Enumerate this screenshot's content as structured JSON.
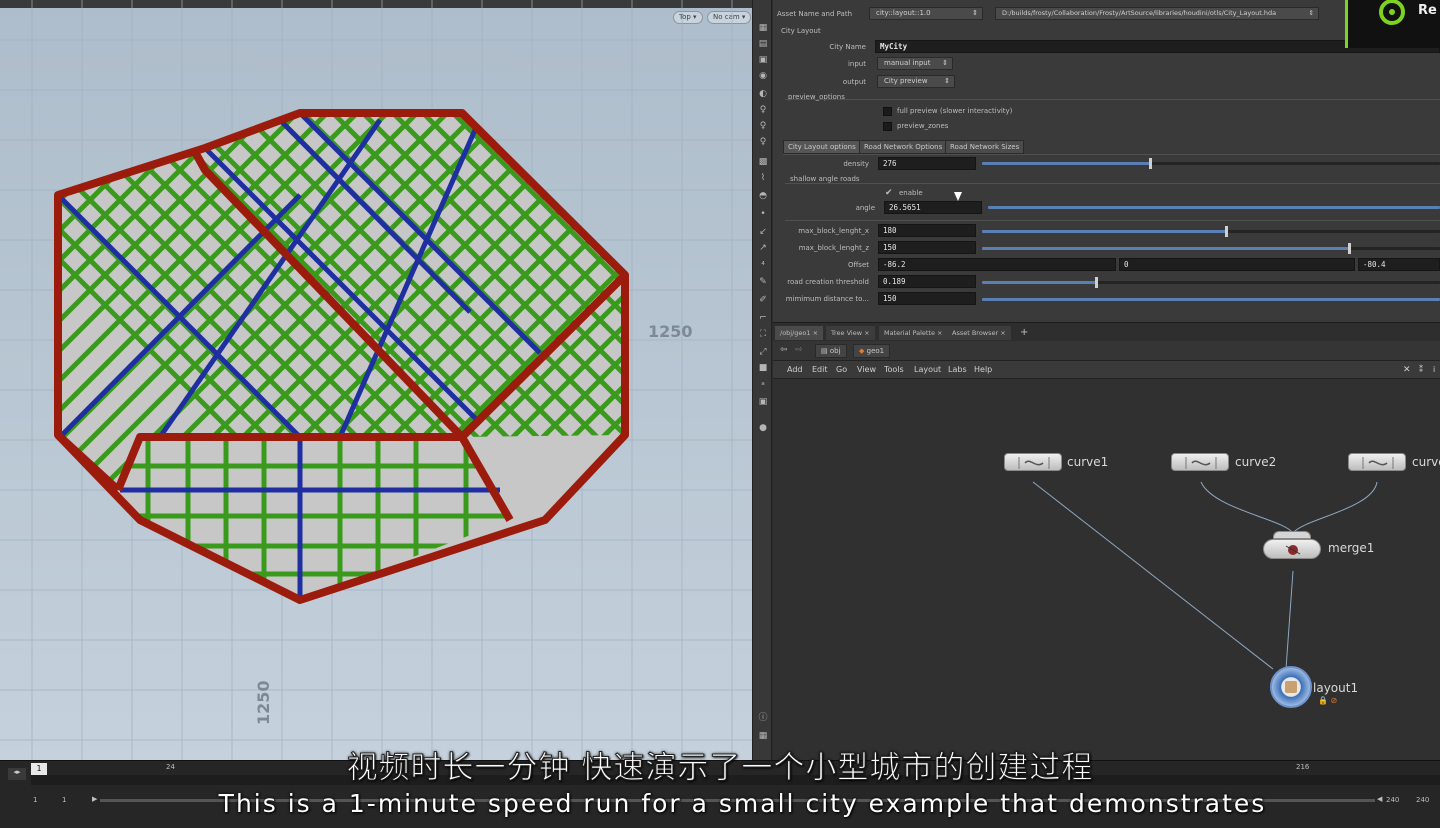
{
  "viewport": {
    "view_label": "Top",
    "camera_label": "No cam",
    "grid_label_right": "1250",
    "grid_label_bottom": "1250"
  },
  "params": {
    "asset_name_label": "Asset Name and Path",
    "asset_name_value": "city::layout::1.0",
    "asset_path_value": "D:/builds/frosty/Collaboration/Frosty/ArtSource/libraries/houdini/otls/City_Layout.hda",
    "section_title": "City Layout",
    "city_name_label": "City Name",
    "city_name_value": "MyCity",
    "input_label": "input",
    "input_value": "manual input",
    "output_label": "output",
    "output_value": "City preview",
    "preview_options_label": "preview_options",
    "full_preview_label": "full preview (slower interactivity)",
    "preview_zones_label": "preview_zones",
    "tabs": [
      "City Layout options",
      "Road Network Options",
      "Road Network Sizes"
    ],
    "density_label": "density",
    "density_value": "276",
    "shallow_label": "shallow angle roads",
    "enable_label": "enable",
    "angle_label": "angle",
    "angle_value": "26.5651",
    "max_block_x_label": "max_block_lenght_x",
    "max_block_x_value": "180",
    "max_block_z_label": "max_block_lenght_z",
    "max_block_z_value": "150",
    "offset_label": "Offset",
    "offset_x": "-86.2",
    "offset_y": "0",
    "offset_z": "-80.4",
    "road_threshold_label": "road creation threshold",
    "road_threshold_value": "0.189",
    "min_distance_label": "mimimum distance to...",
    "min_distance_value": "150"
  },
  "network": {
    "tabs": [
      "/obj/geo1",
      "Tree View",
      "Material Palette",
      "Asset Browser"
    ],
    "path_obj": "obj",
    "path_geo": "geo1",
    "menu": [
      "Add",
      "Edit",
      "Go",
      "View",
      "Tools",
      "Layout",
      "Labs",
      "Help"
    ],
    "nodes": {
      "curve1": "curve1",
      "curve2": "curve2",
      "curve3": "curve",
      "merge1": "merge1",
      "layout1": "layout1"
    }
  },
  "timeline": {
    "current_frame": "1",
    "start_frame": "1",
    "start_frame2": "1",
    "tick_24": "24",
    "tick_216": "216",
    "end_frame": "240",
    "end_frame2": "240"
  },
  "logo_text": "Re",
  "subtitles": {
    "zh": "视频时长一分钟 快速演示了一个小型城市的创建过程",
    "en": "This is a 1-minute speed run for a small city example that demonstrates"
  },
  "colors": {
    "boundary_road": "#9b1c0c",
    "main_road": "#1f2fa0",
    "minor_road": "#3a9a1c",
    "accent": "#7ed321"
  }
}
